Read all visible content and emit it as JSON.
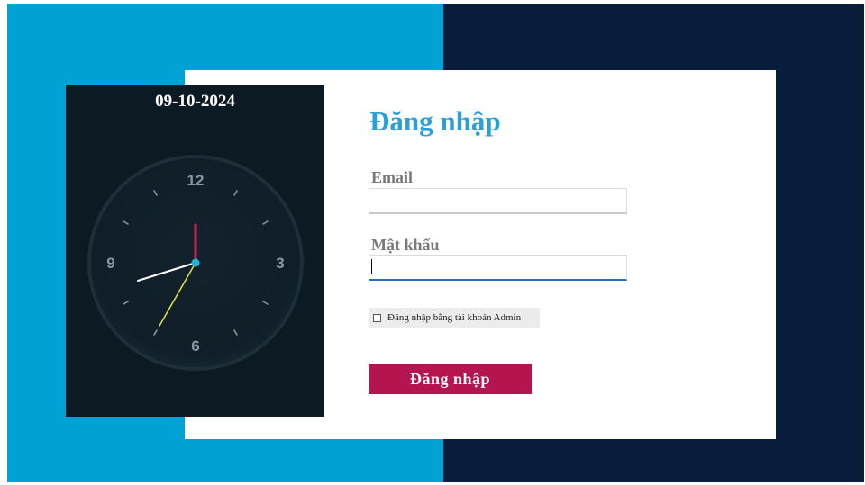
{
  "clock": {
    "date": "09-10-2024",
    "numerals": {
      "twelve": "12",
      "three": "3",
      "six": "6",
      "nine": "9"
    }
  },
  "login": {
    "title": "Đăng nhập",
    "email_label": "Email",
    "email_value": "",
    "password_label": "Mật khẩu",
    "password_value": "",
    "admin_checkbox_label": "Đăng nhập bằng tài khoản Admin",
    "admin_checked": false,
    "submit_label": "Đăng nhập"
  },
  "colors": {
    "left_background": "#00a2d3",
    "right_background": "#071d3b",
    "clock_panel": "#0c1a24",
    "title": "#2a9fd8",
    "submit_button": "#b4154f",
    "clock_center": "#1fb7d6",
    "hour_hand": "#d81b60",
    "minute_hand": "#ffffff",
    "second_hand": "#e6e24a"
  }
}
